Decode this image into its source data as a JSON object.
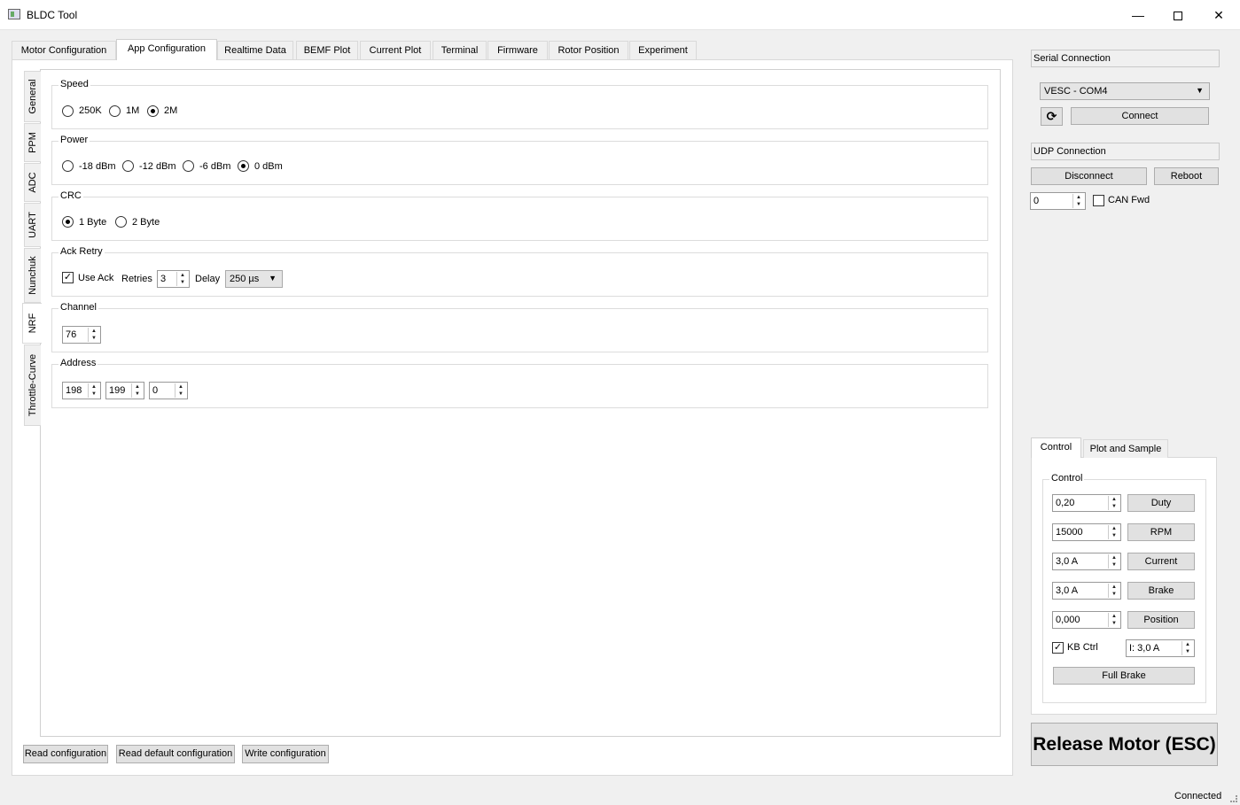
{
  "window": {
    "title": "BLDC Tool",
    "minimize": "—",
    "close": "✕"
  },
  "main_tabs": [
    "Motor Configuration",
    "App Configuration",
    "Realtime Data",
    "BEMF Plot",
    "Current Plot",
    "Terminal",
    "Firmware",
    "Rotor Position",
    "Experiment"
  ],
  "side_tabs": [
    "General",
    "PPM",
    "ADC",
    "UART",
    "Nunchuk",
    "NRF",
    "Throttle-Curve"
  ],
  "nrf": {
    "speed": {
      "title": "Speed",
      "options": [
        "250K",
        "1M",
        "2M"
      ],
      "selected": "2M"
    },
    "power": {
      "title": "Power",
      "options": [
        "-18 dBm",
        "-12 dBm",
        "-6 dBm",
        "0 dBm"
      ],
      "selected": "0 dBm"
    },
    "crc": {
      "title": "CRC",
      "options": [
        "1 Byte",
        "2 Byte"
      ],
      "selected": "1 Byte"
    },
    "ack_retry": {
      "title": "Ack Retry",
      "use_ack_label": "Use Ack",
      "use_ack_checked": true,
      "retries_label": "Retries",
      "retries_value": "3",
      "delay_label": "Delay",
      "delay_value": "250 µs"
    },
    "channel": {
      "title": "Channel",
      "value": "76"
    },
    "address": {
      "title": "Address",
      "values": [
        "198",
        "199",
        "0"
      ]
    }
  },
  "bottom_buttons": {
    "read": "Read configuration",
    "read_default": "Read default configuration",
    "write": "Write configuration"
  },
  "serial": {
    "title": "Serial Connection",
    "port": "VESC - COM4",
    "connect": "Connect",
    "refresh_icon": "refresh-icon"
  },
  "udp": {
    "title": "UDP Connection",
    "disconnect": "Disconnect",
    "reboot": "Reboot",
    "can_id": "0",
    "can_fwd_label": "CAN Fwd",
    "can_fwd_checked": false
  },
  "control_tabs": [
    "Control",
    "Plot and Sample"
  ],
  "control": {
    "title": "Control",
    "rows": [
      {
        "value": "0,20",
        "button": "Duty"
      },
      {
        "value": "15000",
        "button": "RPM"
      },
      {
        "value": "3,0 A",
        "button": "Current"
      },
      {
        "value": "3,0 A",
        "button": "Brake"
      },
      {
        "value": "0,000",
        "button": "Position"
      }
    ],
    "kb_ctrl_label": "KB Ctrl",
    "kb_ctrl_checked": true,
    "kb_current": "I: 3,0 A",
    "full_brake": "Full Brake"
  },
  "release": "Release Motor (ESC)",
  "status": "Connected"
}
